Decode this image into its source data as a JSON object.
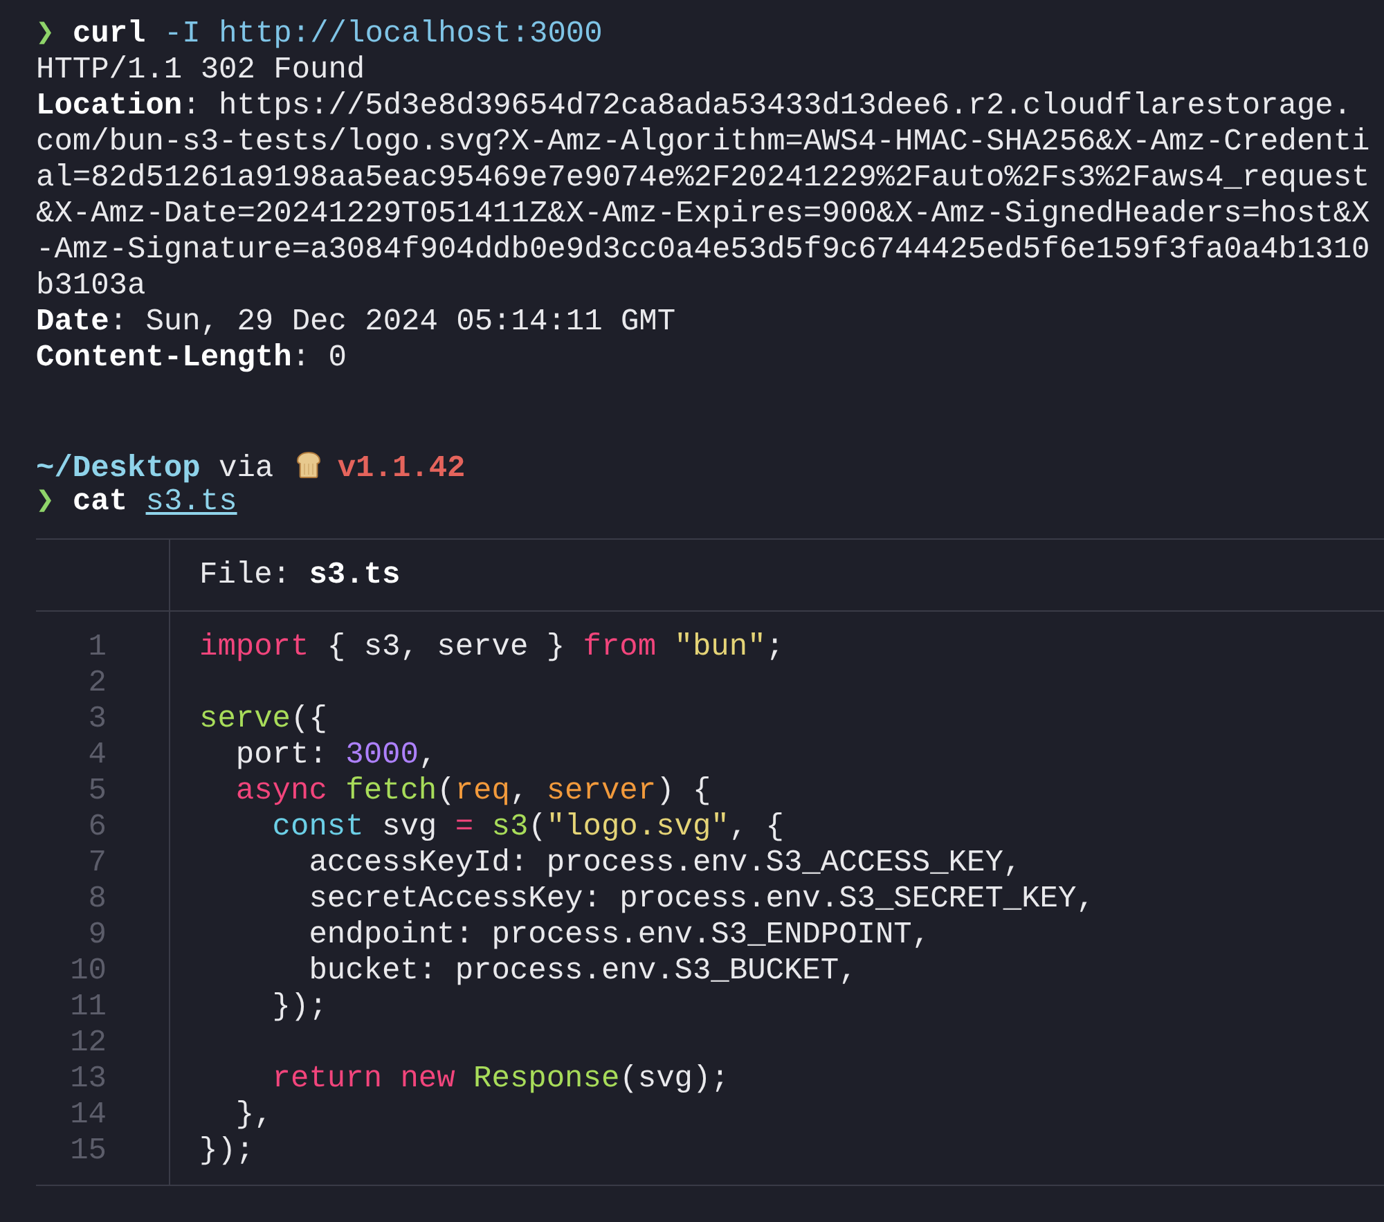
{
  "curl_command": {
    "prompt": "❯",
    "program": "curl",
    "flag": "-I",
    "url": "http://localhost:3000"
  },
  "response": {
    "status": "HTTP/1.1 302 Found",
    "headers": [
      {
        "name": "Location",
        "separator": ":",
        "value": "https://5d3e8d39654d72ca8ada53433d13dee6.r2.cloudflarestorage.com/bun-s3-tests/logo.svg?X-Amz-Algorithm=AWS4-HMAC-SHA256&X-Amz-Credential=82d51261a9198aa5eac95469e7e9074e%2F20241229%2Fauto%2Fs3%2Faws4_request&X-Amz-Date=20241229T051411Z&X-Amz-Expires=900&X-Amz-SignedHeaders=host&X-Amz-Signature=a3084f904ddb0e9d3cc0a4e53d5f9c6744425ed5f6e159f3fa0a4b1310b3103a"
      },
      {
        "name": "Date",
        "separator": ":",
        "value": "Sun, 29 Dec 2024 05:14:11 GMT"
      },
      {
        "name": "Content-Length",
        "separator": ":",
        "value": "0"
      }
    ]
  },
  "prompt_line": {
    "path": "~/Desktop",
    "via": "via",
    "version": "v1.1.42"
  },
  "cat_command": {
    "prompt": "❯",
    "program": "cat",
    "file": "s3.ts"
  },
  "file_viewer": {
    "header_label": "File:",
    "file_name": "s3.ts",
    "lines": [
      {
        "number": "1",
        "tokens": [
          {
            "kind": "keyword",
            "text": "import"
          },
          {
            "kind": "plain",
            "text": " { s3, serve } "
          },
          {
            "kind": "keyword",
            "text": "from"
          },
          {
            "kind": "string",
            "text": " \"bun\""
          },
          {
            "kind": "plain",
            "text": ";"
          }
        ]
      },
      {
        "number": "2"
      },
      {
        "number": "3",
        "tokens": [
          {
            "kind": "function",
            "text": "serve"
          },
          {
            "kind": "plain",
            "text": "({"
          }
        ]
      },
      {
        "number": "4",
        "tokens": [
          {
            "kind": "plain",
            "text": "  port: "
          },
          {
            "kind": "number",
            "text": "3000"
          },
          {
            "kind": "plain",
            "text": ","
          }
        ]
      },
      {
        "number": "5",
        "tokens": [
          {
            "kind": "keyword",
            "text": "  async"
          },
          {
            "kind": "function",
            "text": " fetch"
          },
          {
            "kind": "plain",
            "text": "("
          },
          {
            "kind": "param",
            "text": "req"
          },
          {
            "kind": "plain",
            "text": ", "
          },
          {
            "kind": "param",
            "text": "server"
          },
          {
            "kind": "plain",
            "text": ") {"
          }
        ]
      },
      {
        "number": "6",
        "tokens": [
          {
            "kind": "storage",
            "text": "    const"
          },
          {
            "kind": "plain",
            "text": " svg "
          },
          {
            "kind": "keyword",
            "text": "="
          },
          {
            "kind": "function",
            "text": " s3"
          },
          {
            "kind": "plain",
            "text": "("
          },
          {
            "kind": "string",
            "text": "\"logo.svg\""
          },
          {
            "kind": "plain",
            "text": ", {"
          }
        ]
      },
      {
        "number": "7",
        "tokens": [
          {
            "kind": "plain",
            "text": "      accessKeyId: process.env.S3_ACCESS_KEY,"
          }
        ]
      },
      {
        "number": "8",
        "tokens": [
          {
            "kind": "plain",
            "text": "      secretAccessKey: process.env.S3_SECRET_KEY,"
          }
        ]
      },
      {
        "number": "9",
        "tokens": [
          {
            "kind": "plain",
            "text": "      endpoint: process.env.S3_ENDPOINT,"
          }
        ]
      },
      {
        "number": "10",
        "tokens": [
          {
            "kind": "plain",
            "text": "      bucket: process.env.S3_BUCKET,"
          }
        ]
      },
      {
        "number": "11",
        "tokens": [
          {
            "kind": "plain",
            "text": "    });"
          }
        ]
      },
      {
        "number": "12"
      },
      {
        "number": "13",
        "tokens": [
          {
            "kind": "keyword",
            "text": "    return"
          },
          {
            "kind": "keyword",
            "text": " new"
          },
          {
            "kind": "function",
            "text": " Response"
          },
          {
            "kind": "plain",
            "text": "(svg);"
          }
        ]
      },
      {
        "number": "14",
        "tokens": [
          {
            "kind": "plain",
            "text": "  },"
          }
        ]
      },
      {
        "number": "15",
        "tokens": [
          {
            "kind": "plain",
            "text": "});"
          }
        ]
      }
    ]
  }
}
